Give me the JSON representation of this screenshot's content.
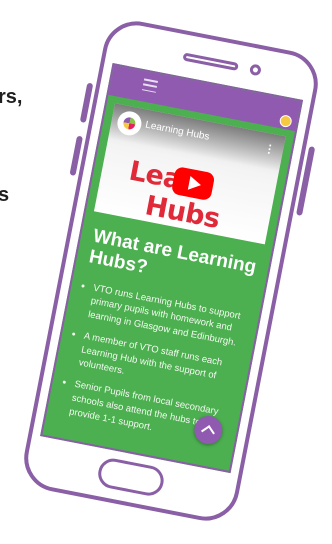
{
  "background_text": {
    "line1": "rs,",
    "line2": "s"
  },
  "app_bar": {
    "menu_icon": "hamburger-menu-icon",
    "logo_icon": "vto-logo-icon"
  },
  "video": {
    "title": "Learning Hubs",
    "thumbnail_left": "Learn",
    "thumbnail_right": "Hubs",
    "play_icon": "youtube-play-icon",
    "more_icon": "kebab-menu-icon"
  },
  "content": {
    "heading": "What are Learning Hubs?",
    "points": [
      "VTO runs Learning Hubs to support primary pupils with homework and learning in Glasgow and Edinburgh.",
      "A member of VTO staff runs each Learning Hub with the support of volunteers.",
      "Senior Pupils from local secondary schools also attend the hubs to provide 1-1 support."
    ]
  },
  "fab": {
    "icon": "chevron-up-icon"
  },
  "colors": {
    "accent": "#8f5ab0",
    "screen_bg": "#4caf50",
    "title_red": "#e02a3a",
    "play_red": "#ff0000"
  }
}
